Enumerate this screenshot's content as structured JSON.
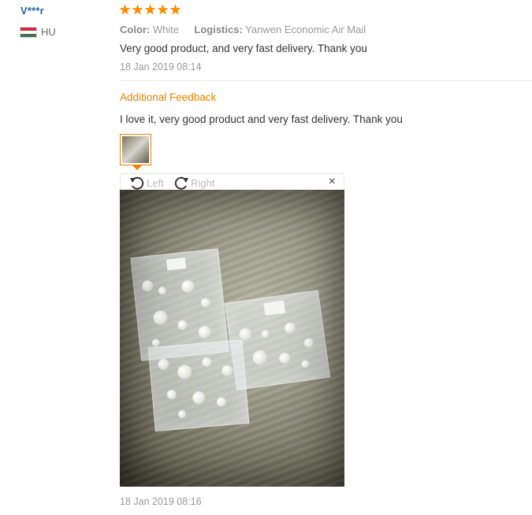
{
  "reviewer": {
    "name": "V***r",
    "country_code": "HU",
    "flag_colors": [
      "#cd2a3e",
      "#ffffff",
      "#436f4d"
    ]
  },
  "rating": {
    "stars": 5,
    "max": 5,
    "color": "#ff8a00"
  },
  "attributes": {
    "color_label": "Color:",
    "color_value": "White",
    "logistics_label": "Logistics:",
    "logistics_value": "Yanwen Economic Air Mail"
  },
  "review": {
    "text": "Very good product, and very fast delivery. Thank you",
    "date": "18 Jan 2019 08:14"
  },
  "additional_feedback": {
    "title": "Additional Feedback",
    "text": "I love it, very good product and very fast delivery. Thank you",
    "date": "18 Jan 2019 08:16"
  },
  "image_viewer": {
    "rotate_left_label": "Left",
    "rotate_right_label": "Right",
    "close_symbol": "×",
    "icons": {
      "rotate_left": "rotate-left-icon",
      "rotate_right": "rotate-right-icon",
      "close": "close-icon"
    }
  },
  "colors": {
    "accent": "#f08200",
    "username": "#1f5fa8"
  }
}
